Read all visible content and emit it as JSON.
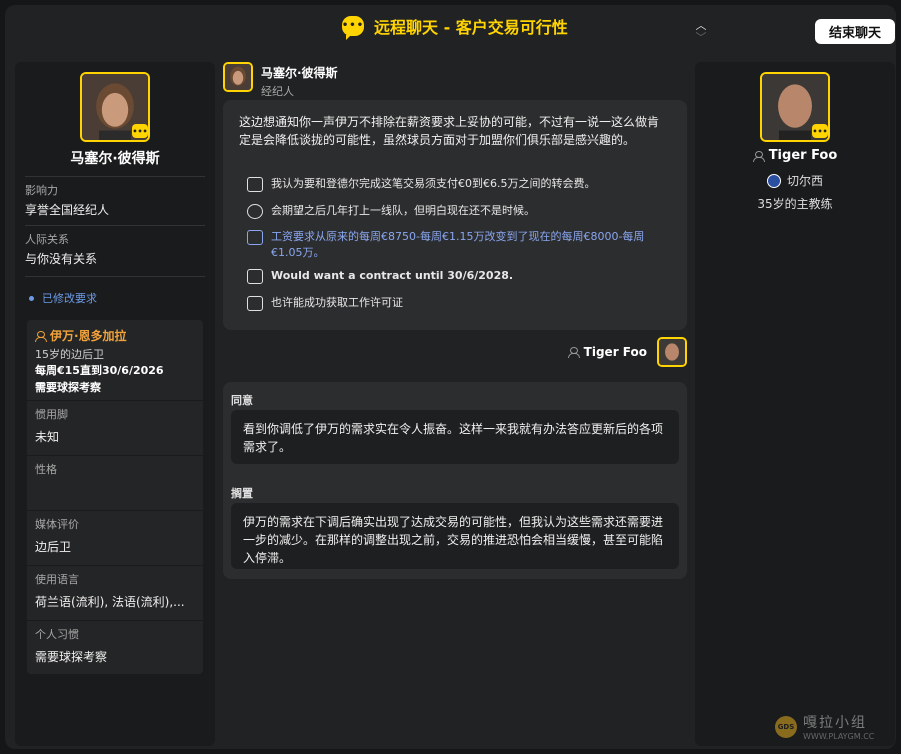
{
  "header": {
    "title": "远程聊天 - 客户交易可行性",
    "end_button": "结束聊天"
  },
  "left": {
    "agent_name": "马塞尔·彼得斯",
    "influence_label": "影响力",
    "influence_value": "享誉全国经纪人",
    "relation_label": "人际关系",
    "relation_value": "与你没有关系",
    "modified_label": "已修改要求",
    "player": {
      "name": "伊万·恩多加拉",
      "age_pos": "15岁的边后卫",
      "contract": "每周€15直到30/6/2026",
      "scout": "需要球探考察",
      "foot_label": "惯用脚",
      "foot_value": "未知",
      "personality_label": "性格",
      "personality_value": "",
      "media_label": "媒体评价",
      "media_value": "边后卫",
      "language_label": "使用语言",
      "language_value": "荷兰语(流利), 法语(流利),...",
      "habits_label": "个人习惯",
      "habits_value": "需要球探考察"
    }
  },
  "chat": {
    "sender_name": "马塞尔·彼得斯",
    "sender_role": "经纪人",
    "message": "这边想通知你一声伊万不排除在薪资要求上妥协的可能，不过有一说一这么做肯定是会降低谈拢的可能性，虽然球员方面对于加盟你们俱乐部是感兴趣的。",
    "reasons": [
      {
        "icon": "money-transfer-icon",
        "text": "我认为要和登德尔完成这笔交易须支付€0到€6.5万之间的转会费。"
      },
      {
        "icon": "first-team-icon",
        "text": "会期望之后几年打上一线队，但明白现在还不是时候。"
      },
      {
        "icon": "wage-document-icon",
        "text": "工资要求从原来的每周€8750-每周€1.15万改变到了现在的每周€8000-每周€1.05万。"
      },
      {
        "icon": "contract-icon",
        "text": "Would want a contract until 30/6/2028."
      },
      {
        "icon": "work-permit-icon",
        "text": "也许能成功获取工作许可证"
      }
    ],
    "reply_name": "Tiger Foo",
    "options": [
      {
        "label": "同意",
        "text": "看到你调低了伊万的需求实在令人振奋。这样一来我就有办法答应更新后的各项需求了。"
      },
      {
        "label": "搁置",
        "text": "伊万的需求在下调后确实出现了达成交易的可能性，但我认为这些需求还需要进一步的减少。在那样的调整出现之前，交易的推进恐怕会相当缓慢，甚至可能陷入停滞。"
      }
    ]
  },
  "right": {
    "coach_name": "Tiger Foo",
    "club": "切尔西",
    "role": "35岁的主教练"
  },
  "watermark": {
    "text": "嘎拉小组",
    "url": "WWW.PLAYGM.CC",
    "logo": "GDS"
  },
  "colors": {
    "accent": "#ffd400",
    "player_name": "#f2a23a",
    "link_blue": "#6d9ae6"
  }
}
